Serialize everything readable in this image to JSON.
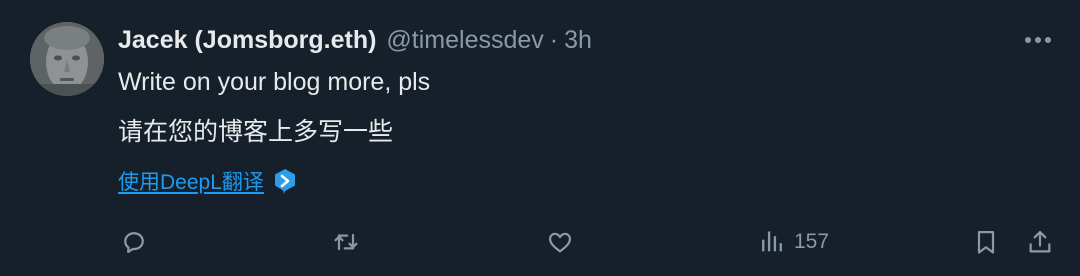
{
  "tweet": {
    "display_name": "Jacek (Jomsborg.eth)",
    "handle": "@timelessdev",
    "separator": "·",
    "time": "3h",
    "text": "Write on your blog more, pls",
    "translation": "请在您的博客上多写一些",
    "translate_link": "使用DeepL翻译"
  },
  "actions": {
    "reply": "reply-icon",
    "retweet": "retweet-icon",
    "like": "heart-icon",
    "views_count": "157",
    "bookmark": "bookmark-icon",
    "share": "share-icon"
  },
  "colors": {
    "background": "#15202b",
    "text": "#e7e9ea",
    "muted": "#8b98a5",
    "link": "#1d9bf0",
    "deepl": "#2d9de6"
  }
}
